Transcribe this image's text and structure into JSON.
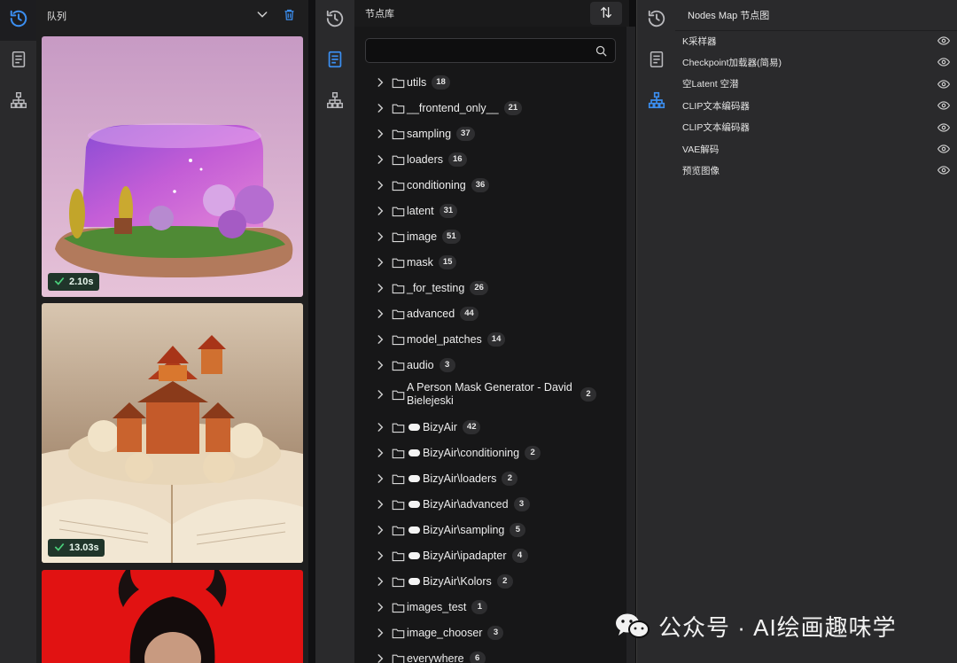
{
  "queue": {
    "title": "队列",
    "items": [
      {
        "time": "2.10s"
      },
      {
        "time": "13.03s"
      },
      {
        "time": ""
      }
    ]
  },
  "library": {
    "title": "节点库",
    "search": {
      "placeholder": "",
      "value": ""
    },
    "folders": [
      {
        "label": "utils",
        "count": "18"
      },
      {
        "label": "__frontend_only__",
        "count": "21"
      },
      {
        "label": "sampling",
        "count": "37"
      },
      {
        "label": "loaders",
        "count": "16"
      },
      {
        "label": "conditioning",
        "count": "36"
      },
      {
        "label": "latent",
        "count": "31"
      },
      {
        "label": "image",
        "count": "51"
      },
      {
        "label": "mask",
        "count": "15"
      },
      {
        "label": "_for_testing",
        "count": "26"
      },
      {
        "label": "advanced",
        "count": "44"
      },
      {
        "label": "model_patches",
        "count": "14"
      },
      {
        "label": "audio",
        "count": "3"
      },
      {
        "label": "A Person Mask Generator - David Bielejeski",
        "count": "2"
      },
      {
        "label": "BizyAir",
        "count": "42",
        "cloud": true
      },
      {
        "label": "BizyAir\\conditioning",
        "count": "2",
        "cloud": true
      },
      {
        "label": "BizyAir\\loaders",
        "count": "2",
        "cloud": true
      },
      {
        "label": "BizyAir\\advanced",
        "count": "3",
        "cloud": true
      },
      {
        "label": "BizyAir\\sampling",
        "count": "5",
        "cloud": true
      },
      {
        "label": "BizyAir\\ipadapter",
        "count": "4",
        "cloud": true
      },
      {
        "label": "BizyAir\\Kolors",
        "count": "2",
        "cloud": true
      },
      {
        "label": "images_test",
        "count": "1"
      },
      {
        "label": "image_chooser",
        "count": "3"
      },
      {
        "label": "everywhere",
        "count": "6"
      }
    ]
  },
  "nodes_map": {
    "title": "Nodes Map 节点图",
    "nodes": [
      {
        "label": "K采样器"
      },
      {
        "label": "Checkpoint加载器(简易)"
      },
      {
        "label": "空Latent 空潜"
      },
      {
        "label": "CLIP文本编码器"
      },
      {
        "label": "CLIP文本编码器"
      },
      {
        "label": "VAE解码"
      },
      {
        "label": "预览图像"
      }
    ]
  },
  "watermark": {
    "text": "公众号 · AI绘画趣味学"
  },
  "colors": {
    "accent": "#3b8ef0",
    "badge_bg": "#20352a",
    "badge_check": "#4ad07a"
  }
}
